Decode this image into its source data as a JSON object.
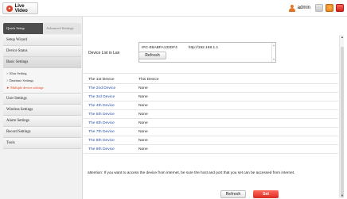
{
  "topbar": {
    "live_video_label": "Live Video",
    "username": "admin"
  },
  "sidebar": {
    "tabs": [
      {
        "label": "Quick Setup"
      },
      {
        "label": "Advanced Settings"
      }
    ],
    "menu": [
      {
        "label": "Setup Wizard"
      },
      {
        "label": "Device Status"
      },
      {
        "label": "Basic Settings"
      }
    ],
    "sub_items": [
      {
        "label": "> Alias Setting"
      },
      {
        "label": "> Datetime Settings"
      },
      {
        "label": "Multiple device settings",
        "mark": "►"
      }
    ],
    "menu_after": [
      {
        "label": "User Settings"
      },
      {
        "label": "Wireless Settings"
      },
      {
        "label": "Alarm Settings"
      },
      {
        "label": "Record Settings"
      },
      {
        "label": "Tools"
      }
    ]
  },
  "lan": {
    "label": "Device List in Lan",
    "entry_name": "IPC-E8ABFA132DF4",
    "entry_url": "http://192.168.1.1",
    "refresh_label": "Refresh"
  },
  "devices": [
    {
      "name": "The 1st Device",
      "value": "This Device"
    },
    {
      "name": "The 2nd Device",
      "value": "None"
    },
    {
      "name": "The 3rd Device",
      "value": "None"
    },
    {
      "name": "The 4th Device",
      "value": "None"
    },
    {
      "name": "The 5th Device",
      "value": "None"
    },
    {
      "name": "The 6th Device",
      "value": "None"
    },
    {
      "name": "The 7th Device",
      "value": "None"
    },
    {
      "name": "The 8th Device",
      "value": "None"
    },
    {
      "name": "The 9th Device",
      "value": "None"
    }
  ],
  "note": "attention: If you want to access the device from internet, be sure the host and port that you set can be accessed from internet.",
  "buttons": {
    "refresh_label": "Refresh",
    "set_label": "Set"
  },
  "colors": {
    "accent_red": "#db2a20",
    "link_blue": "#2d4ea6",
    "active_tab": "#4d4d4d",
    "selected_sub": "#e2471c"
  }
}
